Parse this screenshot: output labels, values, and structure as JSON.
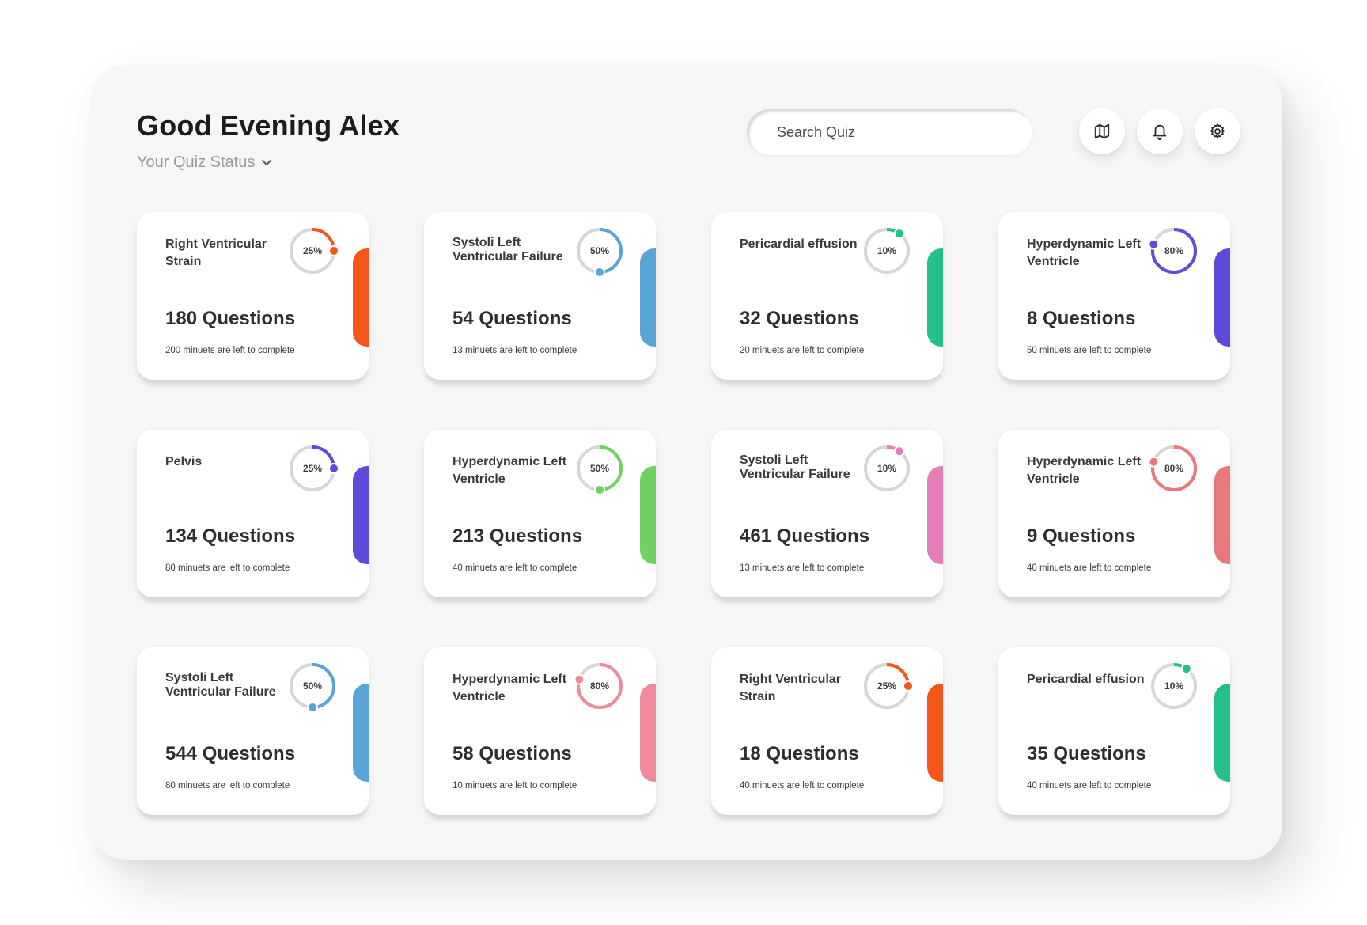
{
  "header": {
    "greeting": "Good Evening Alex",
    "status_label": "Your Quiz Status",
    "search_placeholder": "Search Quiz"
  },
  "toolbar_icons": [
    "map-icon",
    "bell-icon",
    "gear-icon"
  ],
  "quizzes": [
    {
      "title": "Right Ventricular Strain",
      "progress": 25,
      "progress_label": "25%",
      "questions": "180 Questions",
      "time_left": "200 minuets are left to complete",
      "color": "#f4561c"
    },
    {
      "title": "Systoli Left Ventricular Failure",
      "progress": 50,
      "progress_label": "50%",
      "questions": "54 Questions",
      "time_left": "13 minuets are left to complete",
      "color": "#5aa5d8"
    },
    {
      "title": "Pericardial effusion",
      "progress": 10,
      "progress_label": "10%",
      "questions": "32 Questions",
      "time_left": "20 minuets are left to complete",
      "color": "#23c08a"
    },
    {
      "title": "Hyperdynamic Left Ventricle",
      "progress": 80,
      "progress_label": "80%",
      "questions": "8 Questions",
      "time_left": "50 minuets are left to complete",
      "color": "#5f4bd9"
    },
    {
      "title": "Pelvis",
      "progress": 25,
      "progress_label": "25%",
      "questions": "134 Questions",
      "time_left": "80 minuets are left to complete",
      "color": "#5f4bd9"
    },
    {
      "title": "Hyperdynamic Left Ventricle",
      "progress": 50,
      "progress_label": "50%",
      "questions": "213 Questions",
      "time_left": "40 minuets are left to complete",
      "color": "#6fd160"
    },
    {
      "title": "Systoli Left Ventricular Failure",
      "progress": 10,
      "progress_label": "10%",
      "questions": "461 Questions",
      "time_left": "13 minuets are left to complete",
      "color": "#e67fb8"
    },
    {
      "title": "Hyperdynamic Left Ventricle",
      "progress": 80,
      "progress_label": "80%",
      "questions": "9 Questions",
      "time_left": "40 minuets are left to complete",
      "color": "#e8797a"
    },
    {
      "title": "Systoli Left Ventricular Failure",
      "progress": 50,
      "progress_label": "50%",
      "questions": "544 Questions",
      "time_left": "80 minuets are left to complete",
      "color": "#5aa5d8"
    },
    {
      "title": "Hyperdynamic Left Ventricle",
      "progress": 80,
      "progress_label": "80%",
      "questions": "58 Questions",
      "time_left": "10 minuets are left to complete",
      "color": "#ee8a9a"
    },
    {
      "title": "Right Ventricular Strain",
      "progress": 25,
      "progress_label": "25%",
      "questions": "18 Questions",
      "time_left": "40 minuets are left to complete",
      "color": "#f4561c"
    },
    {
      "title": "Pericardial effusion",
      "progress": 10,
      "progress_label": "10%",
      "questions": "35 Questions",
      "time_left": "40 minuets are left to complete",
      "color": "#23c08a"
    }
  ]
}
